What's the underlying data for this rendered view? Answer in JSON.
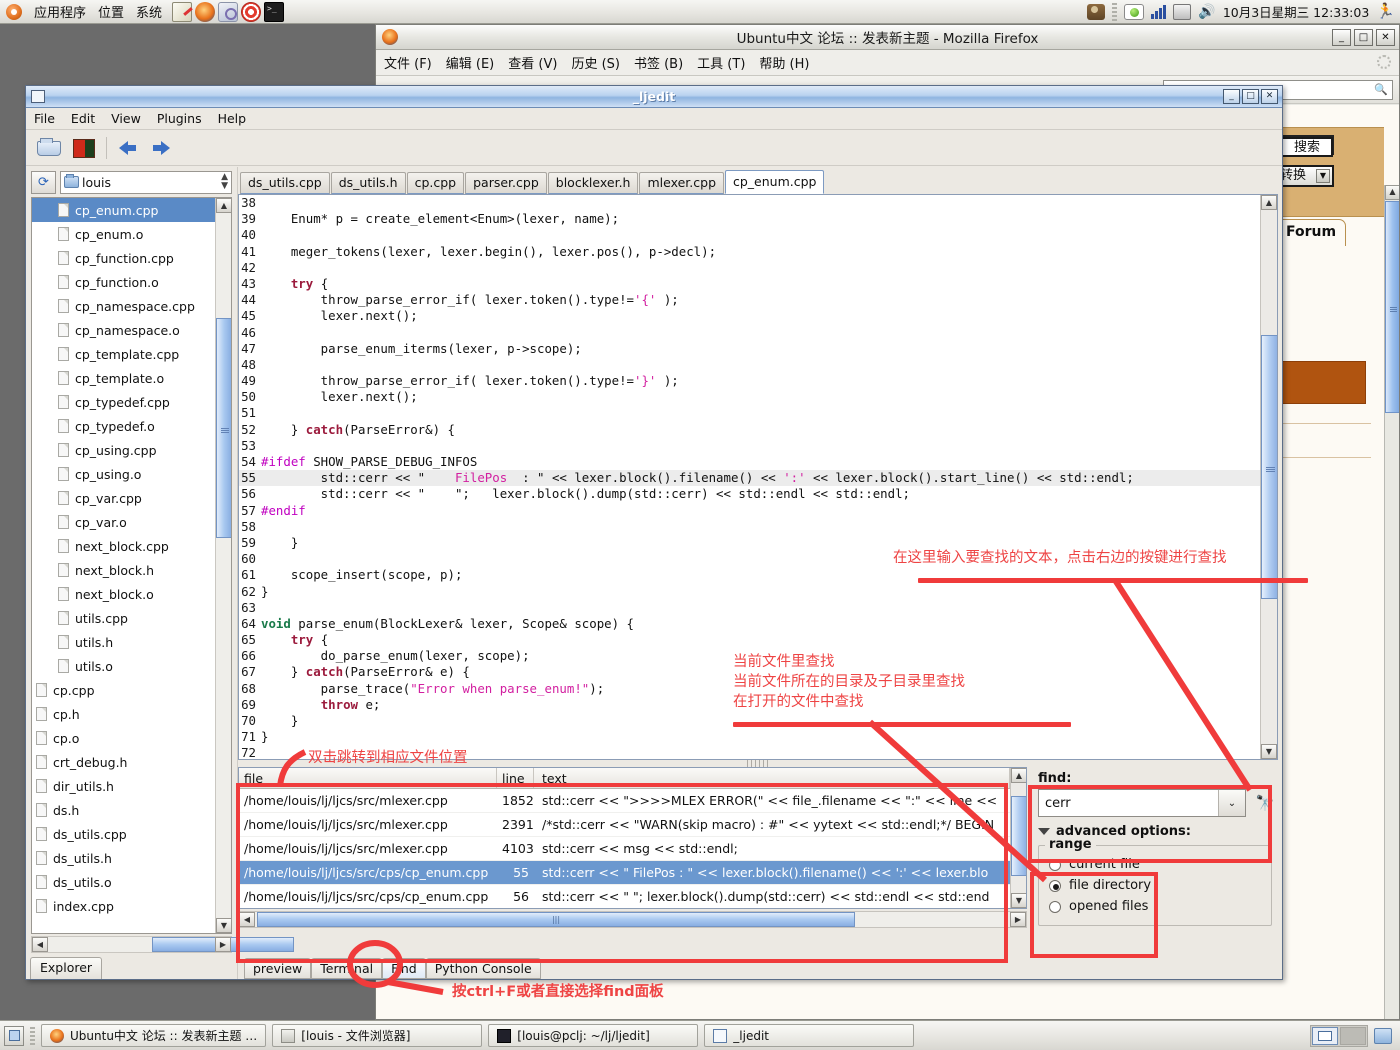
{
  "top_panel": {
    "menus": [
      "应用程序",
      "位置",
      "系统"
    ],
    "launchers": [
      "notes-icon",
      "firefox-icon",
      "help-icon",
      "update-icon",
      "terminal-icon"
    ],
    "tray": [
      "users-icon",
      "im-status-icon",
      "network-icon",
      "printer-icon",
      "volume-icon"
    ],
    "clock": "10月3日星期三 12:33:03",
    "runner_icon": "runner-icon"
  },
  "firefox": {
    "title": "Ubuntu中文 论坛 :: 发表新主题 - Mozilla Firefox",
    "menus": [
      "文件 (F)",
      "编辑 (E)",
      "查看 (V)",
      "历史 (S)",
      "书签 (B)",
      "工具 (T)",
      "帮助 (H)"
    ],
    "window_buttons": [
      "_",
      "□",
      "✕"
    ],
    "page": {
      "search_button": "搜索",
      "select_value": "不转换",
      "forum_tab": "Forum"
    }
  },
  "jjedit": {
    "title": "_ljedit",
    "menus": [
      "File",
      "Edit",
      "View",
      "Plugins",
      "Help"
    ],
    "window_buttons": [
      "_",
      "□",
      "✕"
    ],
    "toolbar": [
      "open-icon",
      "save-icon",
      "back-arrow-icon",
      "forward-arrow-icon"
    ],
    "explorer": {
      "refresh_icon": "refresh-icon",
      "path": "louis",
      "tab_label": "Explorer",
      "files": [
        {
          "name": "cp_enum.cpp",
          "indent": true,
          "selected": true
        },
        {
          "name": "cp_enum.o",
          "indent": true,
          "selected": false
        },
        {
          "name": "cp_function.cpp",
          "indent": true,
          "selected": false
        },
        {
          "name": "cp_function.o",
          "indent": true,
          "selected": false
        },
        {
          "name": "cp_namespace.cpp",
          "indent": true,
          "selected": false
        },
        {
          "name": "cp_namespace.o",
          "indent": true,
          "selected": false
        },
        {
          "name": "cp_template.cpp",
          "indent": true,
          "selected": false
        },
        {
          "name": "cp_template.o",
          "indent": true,
          "selected": false
        },
        {
          "name": "cp_typedef.cpp",
          "indent": true,
          "selected": false
        },
        {
          "name": "cp_typedef.o",
          "indent": true,
          "selected": false
        },
        {
          "name": "cp_using.cpp",
          "indent": true,
          "selected": false
        },
        {
          "name": "cp_using.o",
          "indent": true,
          "selected": false
        },
        {
          "name": "cp_var.cpp",
          "indent": true,
          "selected": false
        },
        {
          "name": "cp_var.o",
          "indent": true,
          "selected": false
        },
        {
          "name": "next_block.cpp",
          "indent": true,
          "selected": false
        },
        {
          "name": "next_block.h",
          "indent": true,
          "selected": false
        },
        {
          "name": "next_block.o",
          "indent": true,
          "selected": false
        },
        {
          "name": "utils.cpp",
          "indent": true,
          "selected": false
        },
        {
          "name": "utils.h",
          "indent": true,
          "selected": false
        },
        {
          "name": "utils.o",
          "indent": true,
          "selected": false
        },
        {
          "name": "cp.cpp",
          "indent": false,
          "selected": false
        },
        {
          "name": "cp.h",
          "indent": false,
          "selected": false
        },
        {
          "name": "cp.o",
          "indent": false,
          "selected": false
        },
        {
          "name": "crt_debug.h",
          "indent": false,
          "selected": false
        },
        {
          "name": "dir_utils.h",
          "indent": false,
          "selected": false
        },
        {
          "name": "ds.h",
          "indent": false,
          "selected": false
        },
        {
          "name": "ds_utils.cpp",
          "indent": false,
          "selected": false
        },
        {
          "name": "ds_utils.h",
          "indent": false,
          "selected": false
        },
        {
          "name": "ds_utils.o",
          "indent": false,
          "selected": false
        },
        {
          "name": "index.cpp",
          "indent": false,
          "selected": false
        }
      ]
    },
    "editor_tabs": [
      {
        "label": "ds_utils.cpp",
        "active": false
      },
      {
        "label": "ds_utils.h",
        "active": false
      },
      {
        "label": "cp.cpp",
        "active": false
      },
      {
        "label": "parser.cpp",
        "active": false
      },
      {
        "label": "blocklexer.h",
        "active": false
      },
      {
        "label": "mlexer.cpp",
        "active": false
      },
      {
        "label": "cp_enum.cpp",
        "active": true
      }
    ],
    "code_lines": [
      {
        "no": "38",
        "segs": [],
        "hl": false
      },
      {
        "no": "39",
        "segs": [
          {
            "t": "    Enum* p = create_element<Enum>(lexer, name);",
            "c": "ctext"
          }
        ],
        "hl": false
      },
      {
        "no": "40",
        "segs": [],
        "hl": false
      },
      {
        "no": "41",
        "segs": [
          {
            "t": "    meger_tokens(lexer, lexer.begin(), lexer.pos(), p->decl);",
            "c": "ctext"
          }
        ],
        "hl": false
      },
      {
        "no": "42",
        "segs": [],
        "hl": false
      },
      {
        "no": "43",
        "segs": [
          {
            "t": "    ",
            "c": "ctext"
          },
          {
            "t": "try",
            "c": "kw"
          },
          {
            "t": " {",
            "c": "ctext"
          }
        ],
        "hl": false
      },
      {
        "no": "44",
        "segs": [
          {
            "t": "        throw_parse_error_if( lexer.token().type!=",
            "c": "ctext"
          },
          {
            "t": "'{'",
            "c": "chr"
          },
          {
            "t": " );",
            "c": "ctext"
          }
        ],
        "hl": false
      },
      {
        "no": "45",
        "segs": [
          {
            "t": "        lexer.next();",
            "c": "ctext"
          }
        ],
        "hl": false
      },
      {
        "no": "46",
        "segs": [],
        "hl": false
      },
      {
        "no": "47",
        "segs": [
          {
            "t": "        parse_enum_iterms(lexer, p->scope);",
            "c": "ctext"
          }
        ],
        "hl": false
      },
      {
        "no": "48",
        "segs": [],
        "hl": false
      },
      {
        "no": "49",
        "segs": [
          {
            "t": "        throw_parse_error_if( lexer.token().type!=",
            "c": "ctext"
          },
          {
            "t": "'}'",
            "c": "chr"
          },
          {
            "t": " );",
            "c": "ctext"
          }
        ],
        "hl": false
      },
      {
        "no": "50",
        "segs": [
          {
            "t": "        lexer.next();",
            "c": "ctext"
          }
        ],
        "hl": false
      },
      {
        "no": "51",
        "segs": [],
        "hl": false
      },
      {
        "no": "52",
        "segs": [
          {
            "t": "    } ",
            "c": "ctext"
          },
          {
            "t": "catch",
            "c": "kw"
          },
          {
            "t": "(ParseError&) {",
            "c": "ctext"
          }
        ],
        "hl": false
      },
      {
        "no": "53",
        "segs": [],
        "hl": false
      },
      {
        "no": "54",
        "segs": [
          {
            "t": "#ifdef",
            "c": "pp"
          },
          {
            "t": " SHOW_PARSE_DEBUG_INFOS",
            "c": "ctext"
          }
        ],
        "hl": false
      },
      {
        "no": "55",
        "segs": [
          {
            "t": "        std::cerr << \"    ",
            "c": "ctext"
          },
          {
            "t": "FilePos",
            "c": "str"
          },
          {
            "t": "  : \" << lexer.block().filename() << ",
            "c": "ctext"
          },
          {
            "t": "':'",
            "c": "chr"
          },
          {
            "t": " << lexer.block().start_line() << std::endl;",
            "c": "ctext"
          }
        ],
        "hl": true
      },
      {
        "no": "56",
        "segs": [
          {
            "t": "        std::cerr << \"    \";   lexer.block().dump(std::cerr) << std::endl << std::endl;",
            "c": "ctext"
          }
        ],
        "hl": false
      },
      {
        "no": "57",
        "segs": [
          {
            "t": "#endif",
            "c": "pp"
          }
        ],
        "hl": false
      },
      {
        "no": "58",
        "segs": [],
        "hl": false
      },
      {
        "no": "59",
        "segs": [
          {
            "t": "    }",
            "c": "ctext"
          }
        ],
        "hl": false
      },
      {
        "no": "60",
        "segs": [],
        "hl": false
      },
      {
        "no": "61",
        "segs": [
          {
            "t": "    scope_insert(scope, p);",
            "c": "ctext"
          }
        ],
        "hl": false
      },
      {
        "no": "62",
        "segs": [
          {
            "t": "}",
            "c": "ctext"
          }
        ],
        "hl": false
      },
      {
        "no": "63",
        "segs": [],
        "hl": false
      },
      {
        "no": "64",
        "segs": [
          {
            "t": "void",
            "c": "kw2"
          },
          {
            "t": " parse_enum(BlockLexer& lexer, Scope& scope) {",
            "c": "ctext"
          }
        ],
        "hl": false
      },
      {
        "no": "65",
        "segs": [
          {
            "t": "    ",
            "c": "ctext"
          },
          {
            "t": "try",
            "c": "kw"
          },
          {
            "t": " {",
            "c": "ctext"
          }
        ],
        "hl": false
      },
      {
        "no": "66",
        "segs": [
          {
            "t": "        do_parse_enum(lexer, scope);",
            "c": "ctext"
          }
        ],
        "hl": false
      },
      {
        "no": "67",
        "segs": [
          {
            "t": "    } ",
            "c": "ctext"
          },
          {
            "t": "catch",
            "c": "kw"
          },
          {
            "t": "(ParseError& e) {",
            "c": "ctext"
          }
        ],
        "hl": false
      },
      {
        "no": "68",
        "segs": [
          {
            "t": "        parse_trace(",
            "c": "ctext"
          },
          {
            "t": "\"Error when parse_enum!\"",
            "c": "str"
          },
          {
            "t": ");",
            "c": "ctext"
          }
        ],
        "hl": false
      },
      {
        "no": "69",
        "segs": [
          {
            "t": "        ",
            "c": "ctext"
          },
          {
            "t": "throw",
            "c": "kw"
          },
          {
            "t": " e;",
            "c": "ctext"
          }
        ],
        "hl": false
      },
      {
        "no": "70",
        "segs": [
          {
            "t": "    }",
            "c": "ctext"
          }
        ],
        "hl": false
      },
      {
        "no": "71",
        "segs": [
          {
            "t": "}",
            "c": "ctext"
          }
        ],
        "hl": false
      },
      {
        "no": "72",
        "segs": [],
        "hl": false
      }
    ],
    "results": {
      "columns": [
        "file",
        "line",
        "text"
      ],
      "rows": [
        {
          "file": "/home/louis/lj/ljcs/src/mlexer.cpp",
          "line": "1852",
          "text": "std::cerr << \">>>>MLEX ERROR(\" << file_.filename << \":\" << line <<",
          "selected": false
        },
        {
          "file": "/home/louis/lj/ljcs/src/mlexer.cpp",
          "line": "2391",
          "text": "/*std::cerr << \"WARN(skip macro) : #\" << yytext << std::endl;*/ BEGIN",
          "selected": false
        },
        {
          "file": "/home/louis/lj/ljcs/src/mlexer.cpp",
          "line": "4103",
          "text": "std::cerr << msg << std::endl;",
          "selected": false
        },
        {
          "file": "/home/louis/lj/ljcs/src/cps/cp_enum.cpp",
          "line": "55",
          "text": "std::cerr << \"   FilePos  : \" << lexer.block().filename() << ':' << lexer.blo",
          "selected": true
        },
        {
          "file": "/home/louis/lj/ljcs/src/cps/cp_enum.cpp",
          "line": "56",
          "text": "std::cerr << \"   \"; lexer.block().dump(std::cerr) << std::endl << std::end",
          "selected": false
        }
      ]
    },
    "find_panel": {
      "label": "find:",
      "query": "cerr",
      "query_placeholder": "",
      "dropdown_icon": "chevron-down-icon",
      "find_icon": "binoculars-icon",
      "advanced_label": "advanced options:",
      "range_legend": "range",
      "range_options": [
        {
          "label": "current file",
          "selected": false
        },
        {
          "label": "file directory",
          "selected": true
        },
        {
          "label": "opened files",
          "selected": false
        }
      ]
    },
    "bottom_tabs": [
      {
        "label": "preview",
        "active": false
      },
      {
        "label": "Terminal",
        "active": false
      },
      {
        "label": "Find",
        "active": true
      },
      {
        "label": "Python Console",
        "active": false
      }
    ]
  },
  "annotations": {
    "find_input_hint": "在这里输入要查找的文本，点击右边的按键进行查找",
    "range_hint_line1": "当前文件里查找",
    "range_hint_line2": "当前文件所在的目录及子目录里查找",
    "range_hint_line3": "在打开的文件中查找",
    "results_hint": "双击跳转到相应文件位置",
    "find_tab_hint": "按ctrl+F或者直接选择find面板"
  },
  "taskbar": {
    "show_desktop_icon": "show-desktop-icon",
    "tasks": [
      {
        "label": "Ubuntu中文 论坛 :: 发表新主题 …",
        "icon": "firefox-icon"
      },
      {
        "label": "[louis - 文件浏览器]",
        "icon": "file-manager-icon"
      },
      {
        "label": "[louis@pclj: ~/lj/ljedit]",
        "icon": "terminal-icon"
      },
      {
        "label": "_ljedit",
        "icon": "jjedit-icon"
      }
    ],
    "workspaces": 2,
    "trash_icon": "trash-icon"
  },
  "colors": {
    "accent": "#5a8ac6",
    "annotation_red": "#f03b3b",
    "selection_blue": "#6b98cf"
  }
}
